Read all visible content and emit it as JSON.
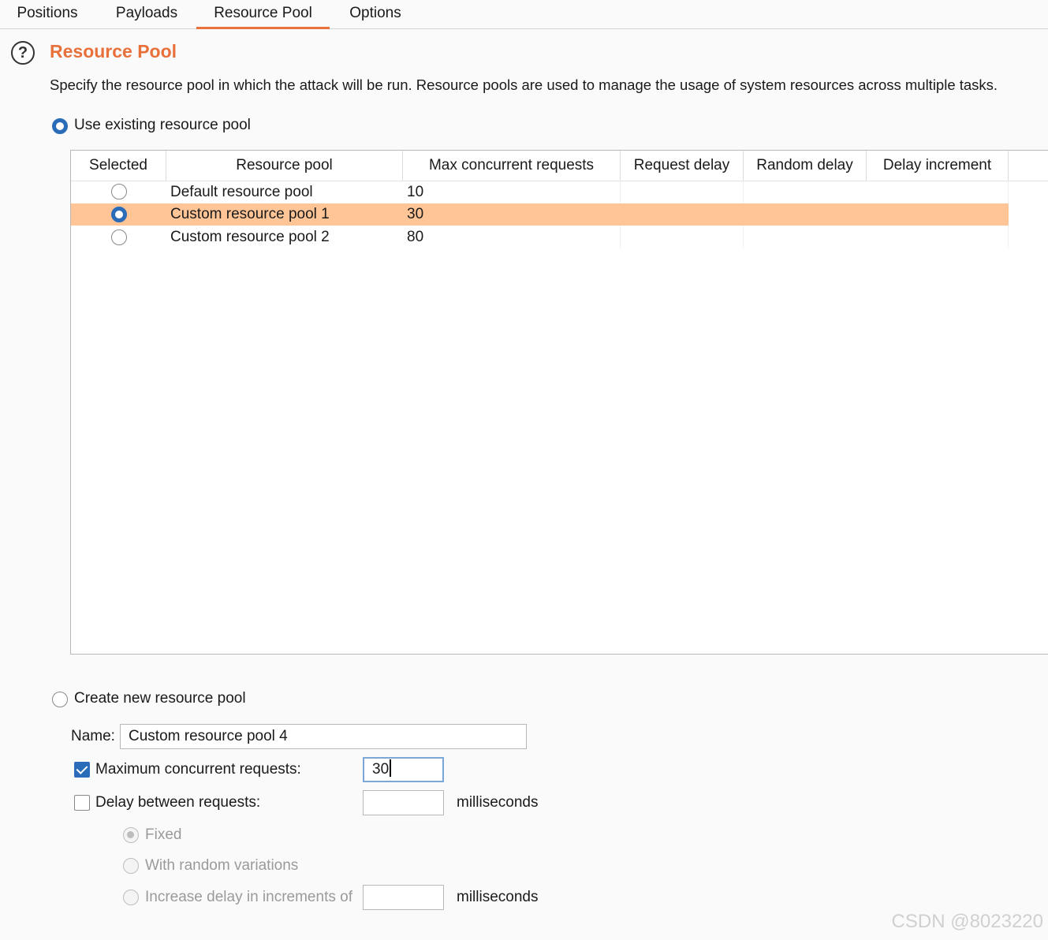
{
  "tabs": [
    {
      "label": "Positions",
      "active": false
    },
    {
      "label": "Payloads",
      "active": false
    },
    {
      "label": "Resource Pool",
      "active": true
    },
    {
      "label": "Options",
      "active": false
    }
  ],
  "header": {
    "help_icon": "?",
    "title": "Resource Pool",
    "description": "Specify the resource pool in which the attack will be run. Resource pools are used to manage the usage of system resources across multiple tasks."
  },
  "existing": {
    "label": "Use existing resource pool",
    "selected": true,
    "table": {
      "columns": [
        "Selected",
        "Resource pool",
        "Max concurrent requests",
        "Request delay",
        "Random delay",
        "Delay increment"
      ],
      "rows": [
        {
          "selected": false,
          "name": "Default resource pool",
          "max": "10",
          "request_delay": "",
          "random_delay": "",
          "delay_increment": ""
        },
        {
          "selected": true,
          "name": "Custom resource pool 1",
          "max": "30",
          "request_delay": "",
          "random_delay": "",
          "delay_increment": ""
        },
        {
          "selected": false,
          "name": "Custom resource pool 2",
          "max": "80",
          "request_delay": "",
          "random_delay": "",
          "delay_increment": ""
        }
      ]
    }
  },
  "create": {
    "label": "Create new resource pool",
    "selected": false,
    "name_label": "Name:",
    "name_value": "Custom resource pool 4",
    "max_concurrent": {
      "label": "Maximum concurrent requests:",
      "checked": true,
      "value": "30"
    },
    "delay": {
      "label": "Delay between requests:",
      "checked": false,
      "value": "",
      "unit": "milliseconds"
    },
    "delay_modes": {
      "fixed": "Fixed",
      "random": "With random variations",
      "increment": "Increase delay in increments of",
      "increment_value": "",
      "increment_unit": "milliseconds"
    }
  },
  "watermark": "CSDN @8023220",
  "colors": {
    "accent": "#e8703a",
    "selected_row": "#ffc596",
    "radio_blue": "#2b6cb8"
  }
}
